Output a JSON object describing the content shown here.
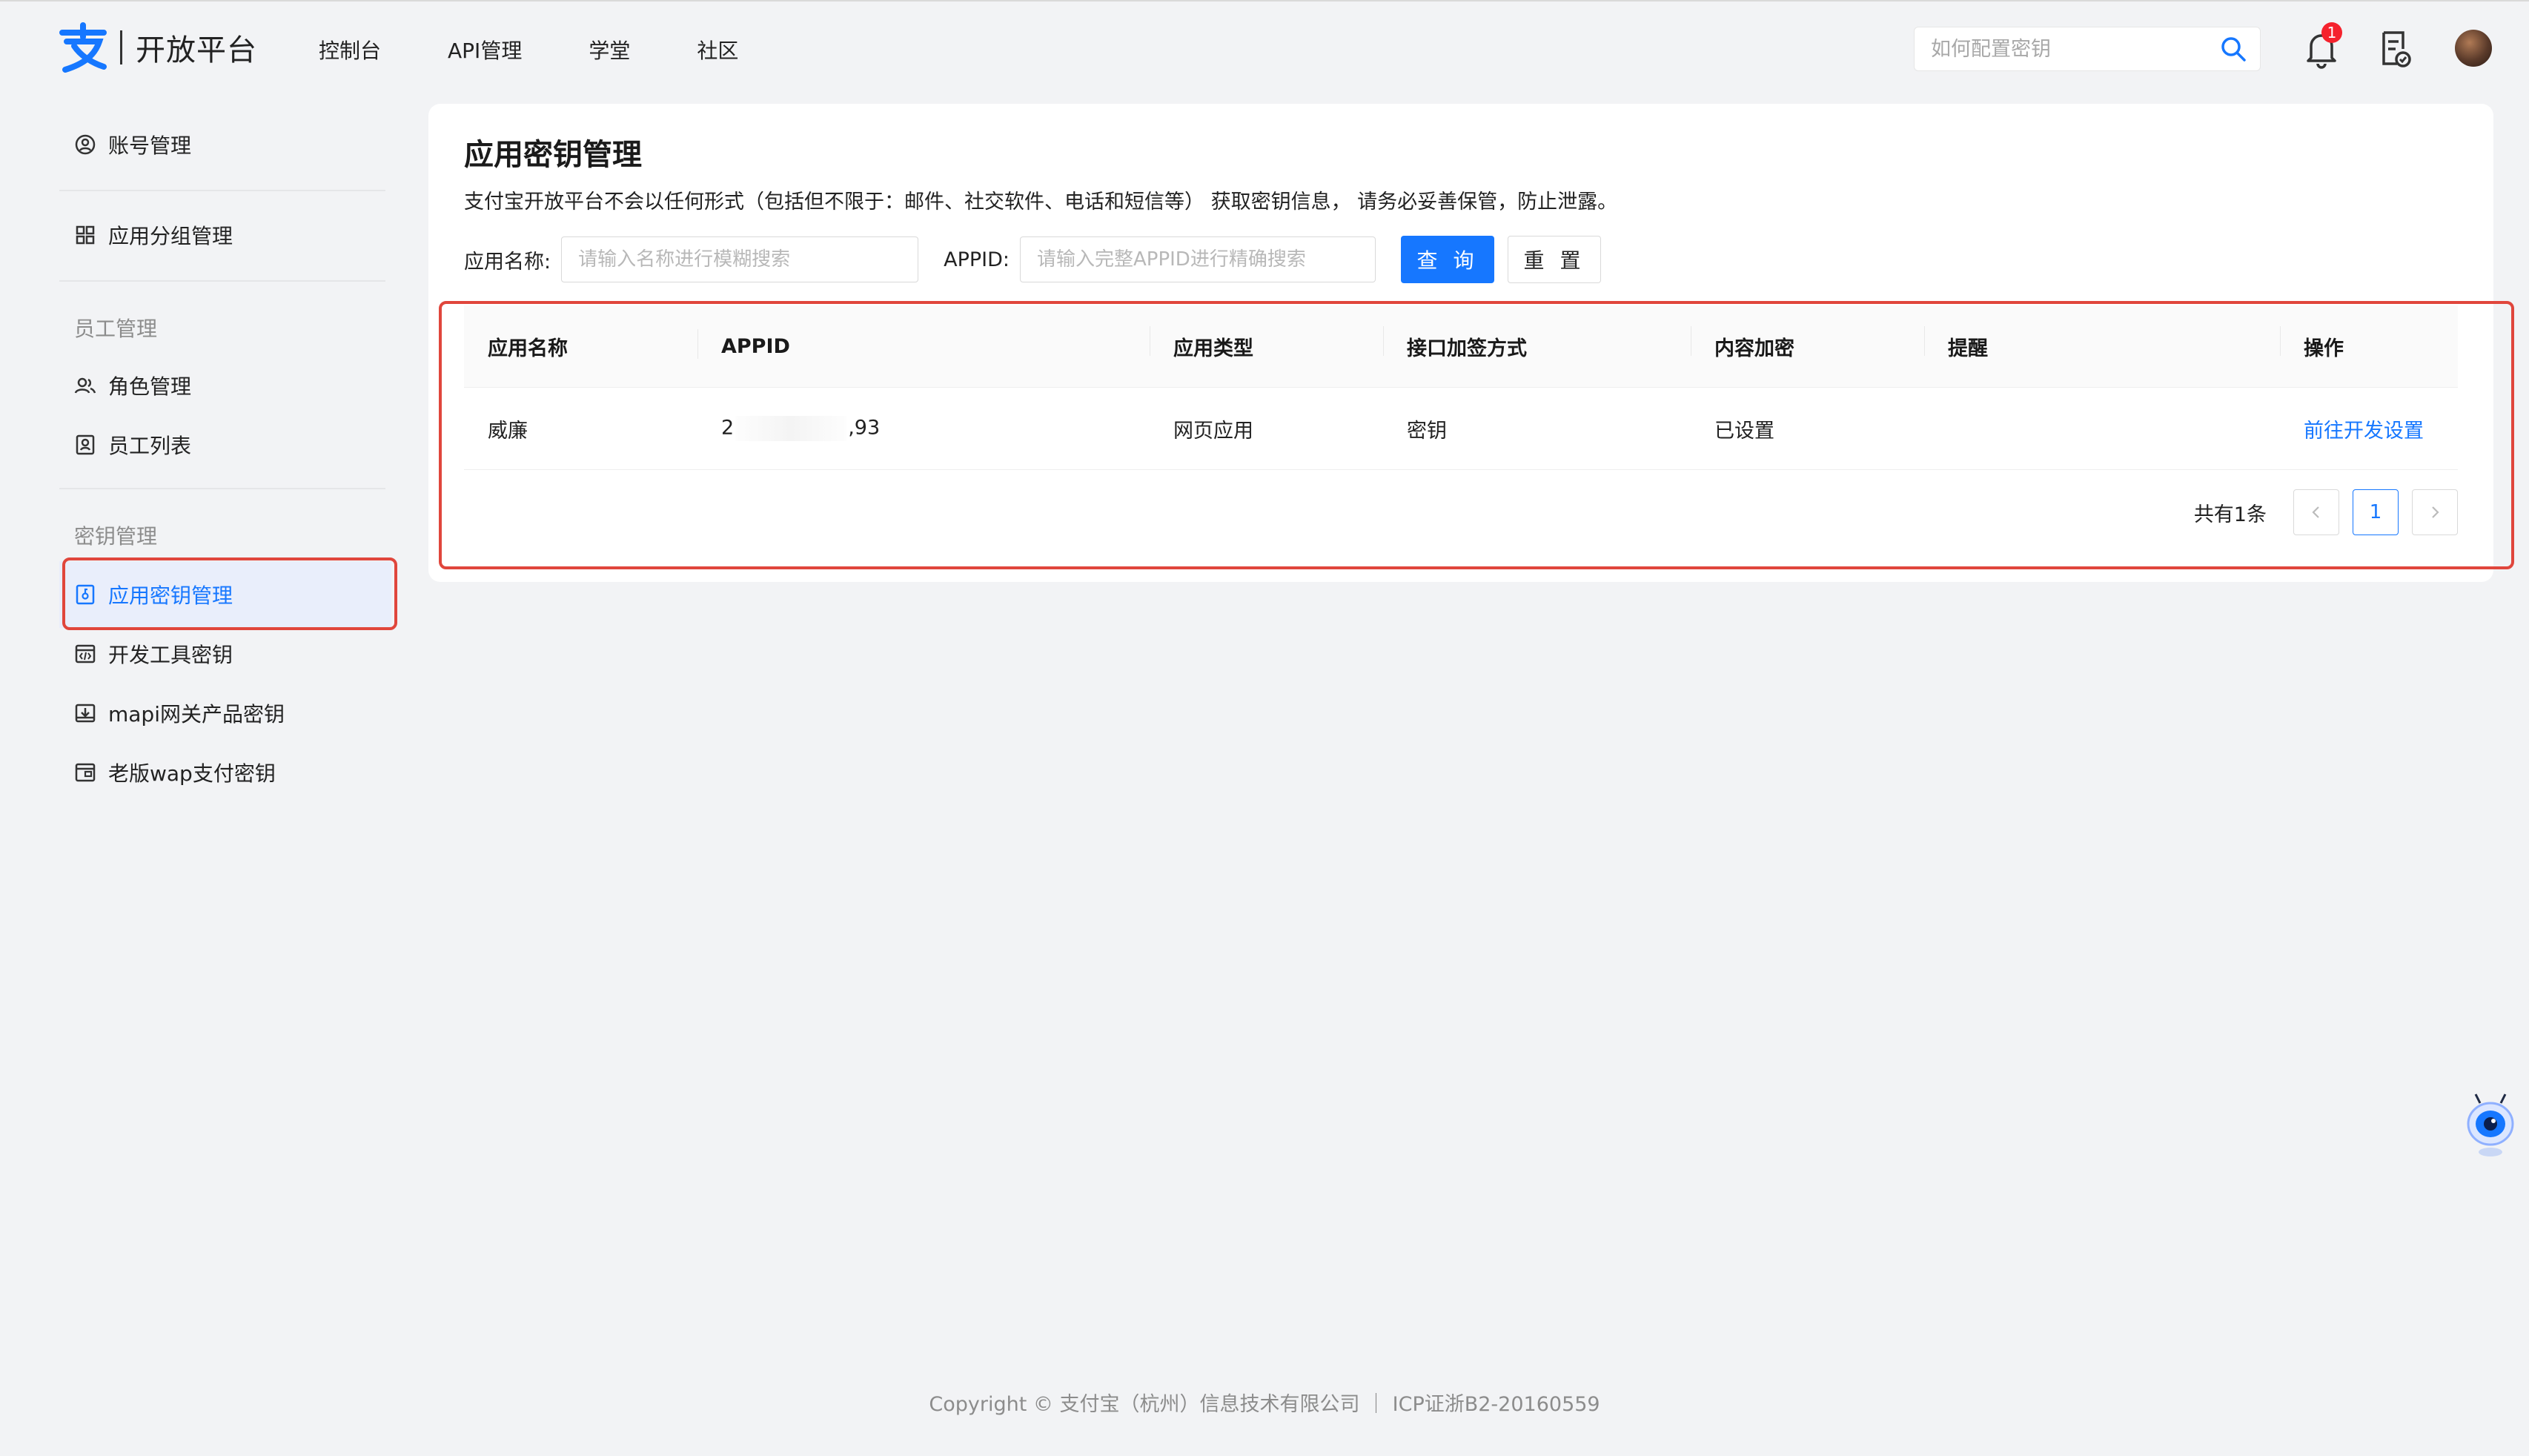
{
  "header": {
    "logo_text": "开放平台",
    "nav": [
      "控制台",
      "API管理",
      "学堂",
      "社区"
    ],
    "search_placeholder": "如何配置密钥",
    "notification_count": "1"
  },
  "sidebar": {
    "items": [
      {
        "label": "账号管理",
        "icon": "user-circle-icon"
      },
      {
        "label": "应用分组管理",
        "icon": "grid-icon"
      }
    ],
    "groups": [
      {
        "title": "员工管理",
        "items": [
          {
            "label": "角色管理",
            "icon": "users-icon"
          },
          {
            "label": "员工列表",
            "icon": "id-card-icon"
          }
        ]
      },
      {
        "title": "密钥管理",
        "items": [
          {
            "label": "应用密钥管理",
            "icon": "key-doc-icon",
            "active": true
          },
          {
            "label": "开发工具密钥",
            "icon": "code-window-icon"
          },
          {
            "label": "mapi网关产品密钥",
            "icon": "download-box-icon"
          },
          {
            "label": "老版wap支付密钥",
            "icon": "wallet-icon"
          }
        ]
      }
    ]
  },
  "main": {
    "title": "应用密钥管理",
    "description": "支付宝开放平台不会以任何形式（包括但不限于：邮件、社交软件、电话和短信等） 获取密钥信息， 请务必妥善保管，防止泄露。",
    "filter": {
      "name_label": "应用名称:",
      "name_placeholder": "请输入名称进行模糊搜索",
      "appid_label": "APPID:",
      "appid_placeholder": "请输入完整APPID进行精确搜索",
      "query_button": "查 询",
      "reset_button": "重 置"
    },
    "table": {
      "columns": [
        "应用名称",
        "APPID",
        "应用类型",
        "接口加签方式",
        "内容加密",
        "提醒",
        "操作"
      ],
      "rows": [
        {
          "name": "威廉",
          "appid_start": "2",
          "appid_end": ",93",
          "type": "网页应用",
          "sign": "密钥",
          "encrypt": "已设置",
          "remind": "",
          "action": "前往开发设置"
        }
      ]
    },
    "pagination": {
      "total": "共有1条",
      "current": "1"
    }
  },
  "footer": "Copyright © 支付宝（杭州）信息技术有限公司 ｜ ICP证浙B2-20160559",
  "colors": {
    "primary": "#1677ff",
    "highlight": "#e0463c",
    "background": "#f2f3f5"
  }
}
